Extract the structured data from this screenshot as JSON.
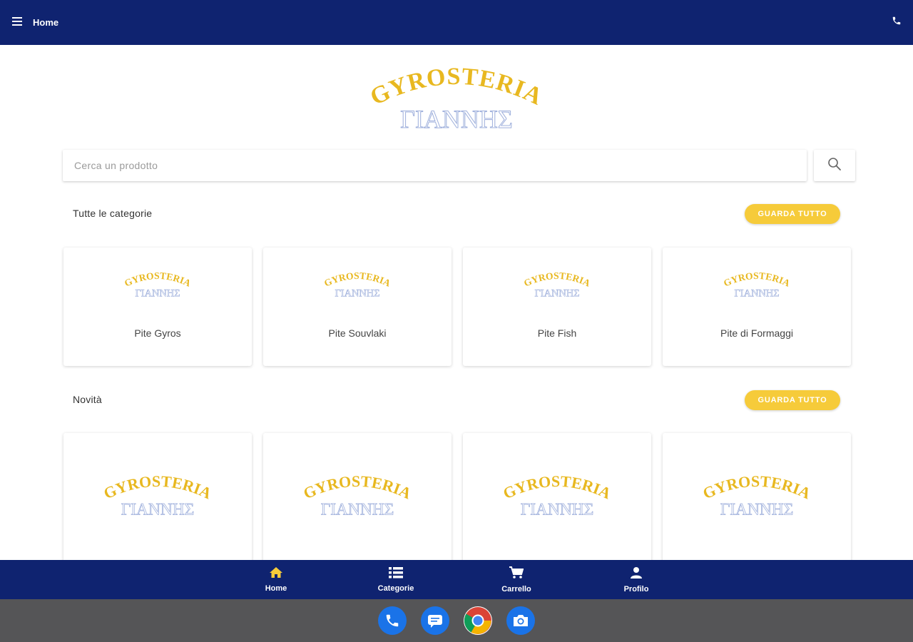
{
  "header": {
    "title": "Home",
    "menu_icon": "menu-icon",
    "phone_icon": "phone-icon",
    "bg_color": "#0f2370"
  },
  "brand": {
    "line1": "GYROSTERIA",
    "line2": "ΓΙΑΝΝΗΣ",
    "gold": "#e8b820",
    "blue": "#9fb0dc"
  },
  "search": {
    "placeholder": "Cerca un prodotto",
    "button_icon": "search-icon"
  },
  "categories": {
    "title": "Tutte le categorie",
    "see_all": "GUARDA TUTTO",
    "items": [
      {
        "label": "Pite Gyros"
      },
      {
        "label": "Pite Souvlaki"
      },
      {
        "label": "Pite Fish"
      },
      {
        "label": "Pite di Formaggi"
      }
    ]
  },
  "news": {
    "title": "Novità",
    "see_all": "GUARDA TUTTO",
    "items": [
      {},
      {},
      {},
      {}
    ]
  },
  "bottom_nav": {
    "items": [
      {
        "label": "Home",
        "icon": "home-icon",
        "active": true
      },
      {
        "label": "Categorie",
        "icon": "list-icon",
        "active": false
      },
      {
        "label": "Carrello",
        "icon": "cart-icon",
        "active": false
      },
      {
        "label": "Profilo",
        "icon": "person-icon",
        "active": false
      }
    ],
    "active_color": "#f6cb3a"
  },
  "dock": {
    "apps": [
      "phone-app-icon",
      "messages-app-icon",
      "chrome-app-icon",
      "camera-app-icon"
    ]
  }
}
